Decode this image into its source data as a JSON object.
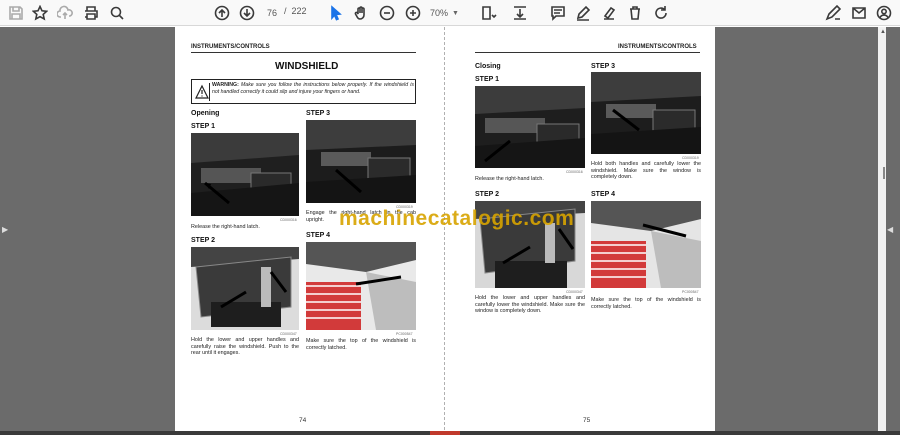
{
  "toolbar": {
    "current_page": "76",
    "page_separator": "/",
    "total_pages": "222",
    "zoom": "70%"
  },
  "left_page": {
    "header": "INSTRUMENTS/CONTROLS",
    "title": "WINDSHIELD",
    "warning_label": "WARNING:",
    "warning_text": "Make sure you follow the instructions below properly. If the windshield is not handled correctly it could slip and injure your fingers or hand.",
    "section": "Opening",
    "step1_heading": "STEP 1",
    "step1_code": "CD000316",
    "step1_caption": "Release the right-hand latch.",
    "step2_heading": "STEP 2",
    "step2_code": "CD000347",
    "step2_caption": "Hold the lower and upper handles and carefully raise the windshield. Push to the rear until it engages.",
    "step3_heading": "STEP 3",
    "step3_code": "CD000319",
    "step3_caption": "Engage the right-hand latch in the cab upright.",
    "step4_heading": "STEP 4",
    "step4_code": "PC000547",
    "step4_caption": "Make sure the top of the windshield is correctly latched.",
    "page_number": "74"
  },
  "right_page": {
    "header": "INSTRUMENTS/CONTROLS",
    "section": "Closing",
    "step1_heading": "STEP 1",
    "step1_code": "CD000316",
    "step1_caption": "Release the right-hand latch.",
    "step2_heading": "STEP 2",
    "step2_code": "CD000347",
    "step2_caption": "Hold the lower and upper handles and carefully lower the windshield. Make sure the window is completely down.",
    "step3_heading": "STEP 3",
    "step3_code": "CD000319",
    "step3_caption": "Hold both handles and carefully lower the windshield. Make sure the window is completely down.",
    "step4_heading": "STEP 4",
    "step4_code": "PC000547",
    "step4_caption": "Make sure the top of the windshield is correctly latched.",
    "page_number": "75"
  },
  "watermark": "machinecatalogic.com",
  "colors": {
    "viewer_bg": "#6b6b6b",
    "watermark": "#d8a400",
    "accent": "#1a73e8"
  }
}
